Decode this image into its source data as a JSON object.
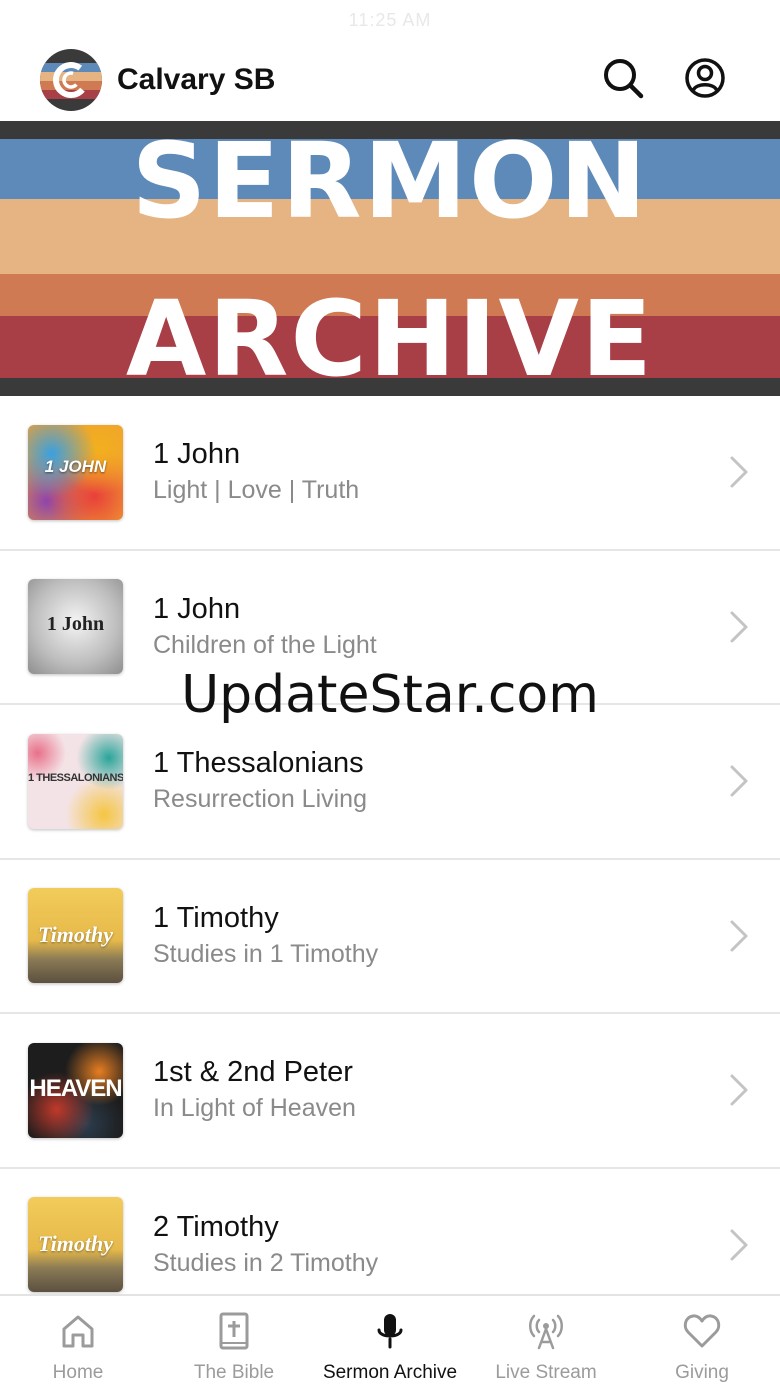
{
  "status_bar": {
    "time": "11:25 AM"
  },
  "header": {
    "app_title": "Calvary SB",
    "logo_icon": "calvary-logo",
    "search_icon": "search-icon",
    "account_icon": "user-circle-icon"
  },
  "banner": {
    "line1": "SERMON",
    "line2": "ARCHIVE",
    "stripe_colors": [
      "#3a3a3a",
      "#5e8ab9",
      "#e5b482",
      "#cf7a52",
      "#a83f46",
      "#3a3a3a"
    ]
  },
  "series": [
    {
      "title": "1 John",
      "subtitle": "Light | Love | Truth",
      "thumb_text": "1 JOHN"
    },
    {
      "title": "1 John",
      "subtitle": "Children of the Light",
      "thumb_text": "1 John"
    },
    {
      "title": "1 Thessalonians",
      "subtitle": "Resurrection Living",
      "thumb_text": "1 THESSALONIANS"
    },
    {
      "title": "1 Timothy",
      "subtitle": "Studies in 1 Timothy",
      "thumb_text": "Timothy"
    },
    {
      "title": "1st & 2nd Peter",
      "subtitle": "In Light of Heaven",
      "thumb_text": "HEAVEN"
    },
    {
      "title": "2 Timothy",
      "subtitle": "Studies in 2 Timothy",
      "thumb_text": "Timothy"
    }
  ],
  "watermark": "UpdateStar.com",
  "tabs": [
    {
      "label": "Home",
      "icon": "home-icon",
      "active": false
    },
    {
      "label": "The Bible",
      "icon": "bible-icon",
      "active": false
    },
    {
      "label": "Sermon Archive",
      "icon": "microphone-icon",
      "active": true
    },
    {
      "label": "Live Stream",
      "icon": "broadcast-icon",
      "active": false
    },
    {
      "label": "Giving",
      "icon": "heart-icon",
      "active": false
    }
  ],
  "colors": {
    "text": "#111111",
    "muted": "#8a8a8a",
    "divider": "#e6e6e6",
    "inactive_tab": "#9b9b9b"
  }
}
